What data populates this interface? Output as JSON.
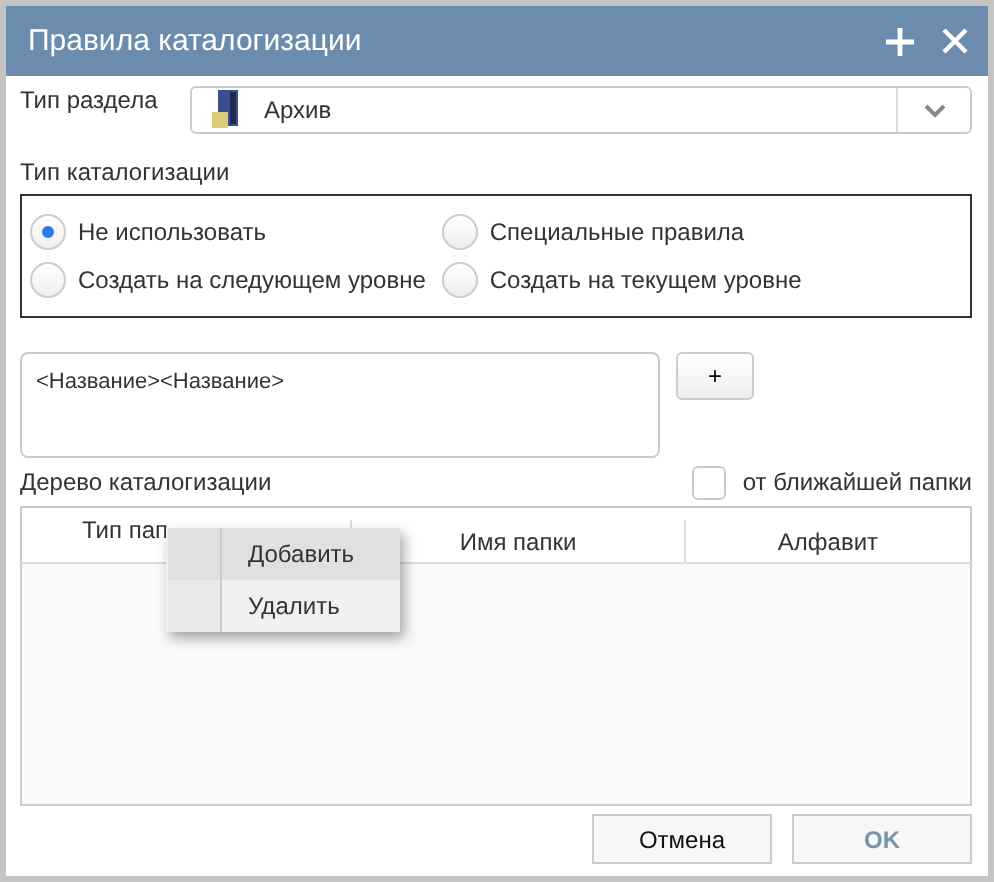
{
  "window": {
    "title": "Правила каталогизации"
  },
  "section_type": {
    "label": "Тип раздела",
    "value": "Архив"
  },
  "cataloging_type": {
    "label": "Тип каталогизации",
    "options": [
      {
        "label": "Не использовать",
        "selected": true
      },
      {
        "label": "Специальные правила",
        "selected": false
      },
      {
        "label": "Создать на следующем уровне",
        "selected": false
      },
      {
        "label": "Создать на текущем уровне",
        "selected": false
      }
    ]
  },
  "template": {
    "value": "<Название><Название>",
    "add_button": "+"
  },
  "tree": {
    "label": "Дерево каталогизации",
    "from_nearest": {
      "label": "от ближайшей папки",
      "checked": false
    },
    "columns": [
      "Тип пап",
      "Имя папки",
      "Алфавит"
    ]
  },
  "context_menu": [
    {
      "label": "Добавить",
      "selected": true
    },
    {
      "label": "Удалить",
      "selected": false
    }
  ],
  "buttons": [
    {
      "label": "Отмена",
      "disabled": false
    },
    {
      "label": "OK",
      "disabled": true
    }
  ]
}
